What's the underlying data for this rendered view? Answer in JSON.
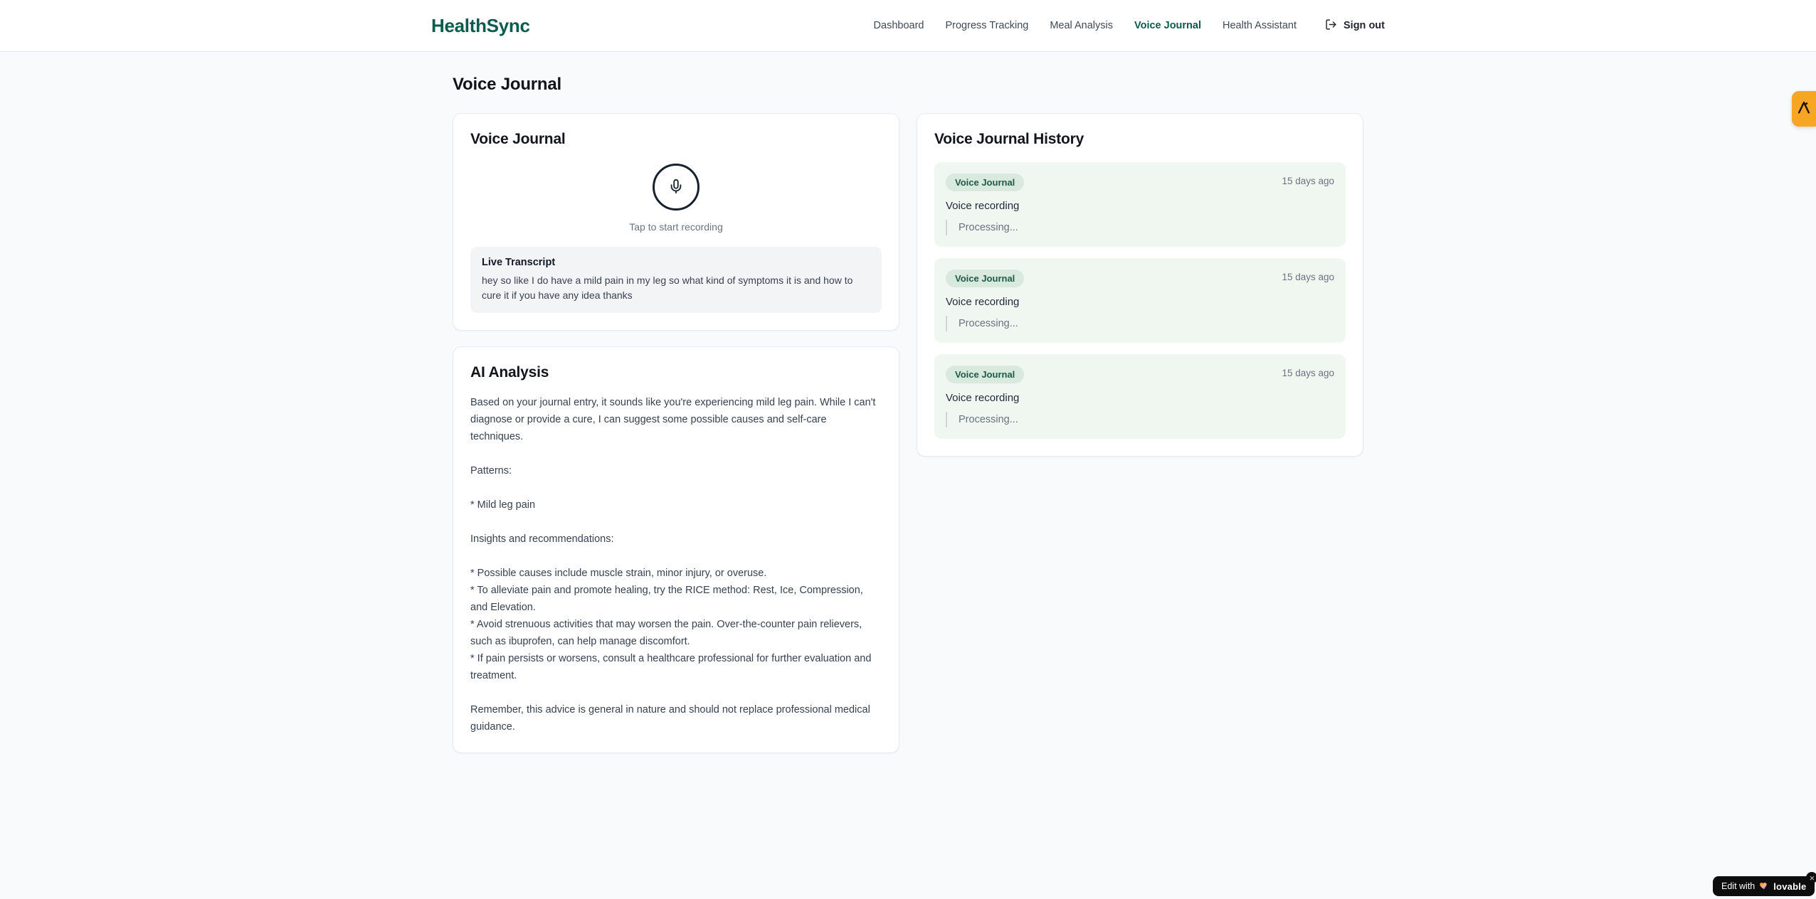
{
  "brand": {
    "name": "HealthSync"
  },
  "nav": {
    "items": [
      {
        "label": "Dashboard",
        "active": false
      },
      {
        "label": "Progress Tracking",
        "active": false
      },
      {
        "label": "Meal Analysis",
        "active": false
      },
      {
        "label": "Voice Journal",
        "active": true
      },
      {
        "label": "Health Assistant",
        "active": false
      }
    ],
    "sign_out_label": "Sign out"
  },
  "page": {
    "title": "Voice Journal"
  },
  "recorder_card": {
    "title": "Voice Journal",
    "tap_hint": "Tap to start recording",
    "transcript_title": "Live Transcript",
    "transcript_text": "hey so like I do have a mild pain in my leg so what kind of symptoms it is and how to cure it if you have any idea thanks"
  },
  "analysis_card": {
    "title": "AI Analysis",
    "body": "Based on your journal entry, it sounds like you're experiencing mild leg pain. While I can't diagnose or provide a cure, I can suggest some possible causes and self-care techniques.\n\nPatterns:\n\n* Mild leg pain\n\nInsights and recommendations:\n\n* Possible causes include muscle strain, minor injury, or overuse.\n* To alleviate pain and promote healing, try the RICE method: Rest, Ice, Compression, and Elevation.\n* Avoid strenuous activities that may worsen the pain. Over-the-counter pain relievers, such as ibuprofen, can help manage discomfort.\n* If pain persists or worsens, consult a healthcare professional for further evaluation and treatment.\n\nRemember, this advice is general in nature and should not replace professional medical guidance."
  },
  "history_card": {
    "title": "Voice Journal History",
    "items": [
      {
        "badge": "Voice Journal",
        "time": "15 days ago",
        "text": "Voice recording",
        "status": "Processing..."
      },
      {
        "badge": "Voice Journal",
        "time": "15 days ago",
        "text": "Voice recording",
        "status": "Processing..."
      },
      {
        "badge": "Voice Journal",
        "time": "15 days ago",
        "text": "Voice recording",
        "status": "Processing..."
      }
    ]
  },
  "widgets": {
    "edit_badge_prefix": "Edit with",
    "edit_badge_brand": "lovable",
    "edit_badge_close": "×"
  },
  "colors": {
    "brand_teal": "#0b5c4d",
    "page_background": "#f8fafc",
    "history_item_bg": "#f0f7f1",
    "badge_bg": "#d9e9de",
    "badge_text": "#1c5b46",
    "amber_launcher": "#f6a623",
    "edit_pill_bg": "#0d0d0d"
  }
}
